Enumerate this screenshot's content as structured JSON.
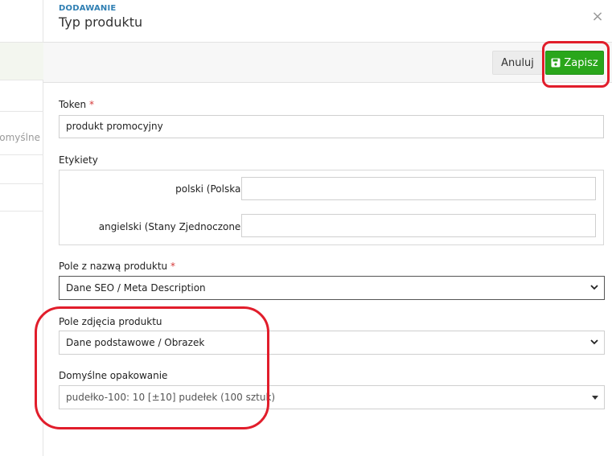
{
  "background": {
    "cut_text": "Domyślne opakowanie"
  },
  "modal": {
    "overline": "DODAWANIE",
    "title": "Typ produktu",
    "close_glyph": "×"
  },
  "toolbar": {
    "cancel_label": "Anuluj",
    "save_label": "Zapisz"
  },
  "form": {
    "token": {
      "label": "Token",
      "required_mark": "*",
      "value": "produkt promocyjny"
    },
    "labels": {
      "label": "Etykiety",
      "items": [
        {
          "language": "polski (Polska)",
          "value": ""
        },
        {
          "language": "angielski (Stany Zjednoczone)",
          "value": ""
        }
      ]
    },
    "name_field": {
      "label": "Pole z nazwą produktu",
      "required_mark": "*",
      "selected": "Dane SEO / Meta Description"
    },
    "photo_field": {
      "label": "Pole zdjęcia produktu",
      "selected": "Dane podstawowe / Obrazek"
    },
    "default_package": {
      "label": "Domyślne opakowanie",
      "selected": "pudełko-100: 10 [±10] pudełek (100 sztuk)"
    }
  },
  "icons": {
    "close": "close-icon",
    "save": "floppy-disk-icon",
    "select": "chevron-down-icon"
  },
  "colors": {
    "accent_blue": "#2f7fb3",
    "save_green": "#2aa61b",
    "highlight_red": "#e11d2b",
    "required_red": "#d63a3a"
  }
}
